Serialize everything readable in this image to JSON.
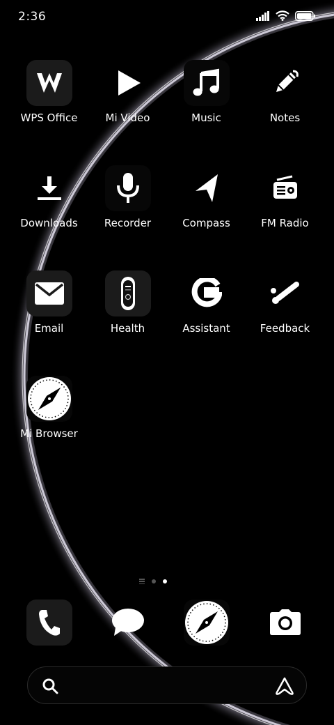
{
  "status_bar": {
    "time": "2:36"
  },
  "apps": [
    {
      "id": "wps-office",
      "label": "WPS Office",
      "icon": "wps-office-icon"
    },
    {
      "id": "mi-video",
      "label": "Mi Video",
      "icon": "play-icon"
    },
    {
      "id": "music",
      "label": "Music",
      "icon": "music-note-icon"
    },
    {
      "id": "notes",
      "label": "Notes",
      "icon": "pencil-icon"
    },
    {
      "id": "downloads",
      "label": "Downloads",
      "icon": "download-icon"
    },
    {
      "id": "recorder",
      "label": "Recorder",
      "icon": "microphone-icon"
    },
    {
      "id": "compass",
      "label": "Compass",
      "icon": "navigation-arrow-icon"
    },
    {
      "id": "fm-radio",
      "label": "FM Radio",
      "icon": "radio-icon"
    },
    {
      "id": "email",
      "label": "Email",
      "icon": "envelope-icon"
    },
    {
      "id": "health",
      "label": "Health",
      "icon": "fitness-band-icon"
    },
    {
      "id": "assistant",
      "label": "Assistant",
      "icon": "google-g-icon"
    },
    {
      "id": "feedback",
      "label": "Feedback",
      "icon": "feedback-icon"
    },
    {
      "id": "mi-browser",
      "label": "Mi Browser",
      "icon": "compass-browser-icon"
    }
  ],
  "dock": [
    {
      "id": "phone",
      "icon": "phone-icon"
    },
    {
      "id": "messages",
      "icon": "chat-bubble-icon"
    },
    {
      "id": "browser",
      "icon": "compass-browser-icon"
    },
    {
      "id": "camera",
      "icon": "camera-icon"
    }
  ],
  "page_indicator": {
    "pages": 2,
    "current": 2
  },
  "colors": {
    "background": "#000000",
    "text": "#ffffff",
    "icon_tile": "#1b1b1b"
  }
}
